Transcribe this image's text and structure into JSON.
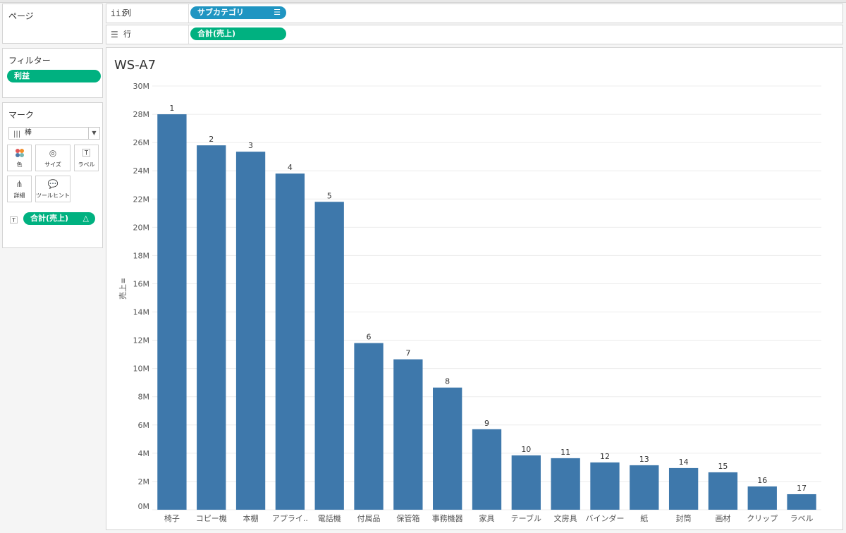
{
  "pages_panel": {
    "title": "ページ"
  },
  "filters_panel": {
    "title": "フィルター",
    "pill": "利益"
  },
  "marks_panel": {
    "title": "マーク",
    "mark_type": "棒",
    "buttons": [
      {
        "label": "色",
        "icon": "color-dots-icon"
      },
      {
        "label": "サイズ",
        "icon": "size-circles-icon"
      },
      {
        "label": "ラベル",
        "icon": "label-text-icon"
      },
      {
        "label": "詳細",
        "icon": "detail-tree-icon"
      },
      {
        "label": "ツールヒント",
        "icon": "tooltip-bubble-icon"
      }
    ],
    "label_pill": "合計(売上)"
  },
  "shelves": {
    "columns": {
      "label": "列",
      "pill": "サブカテゴリ"
    },
    "rows": {
      "label": "行",
      "pill": "合計(売上)"
    }
  },
  "colors": {
    "bar": "#3e78ab",
    "green_pill": "#00b180",
    "blue_pill": "#1f95c2"
  },
  "chart_data": {
    "type": "bar",
    "title": "WS-A7",
    "ylabel": "売上",
    "ylim": [
      0,
      30000000
    ],
    "yticks": [
      0,
      2000000,
      4000000,
      6000000,
      8000000,
      10000000,
      12000000,
      14000000,
      16000000,
      18000000,
      20000000,
      22000000,
      24000000,
      26000000,
      28000000,
      30000000
    ],
    "ytick_labels": [
      "0M",
      "2M",
      "4M",
      "6M",
      "8M",
      "10M",
      "12M",
      "14M",
      "16M",
      "18M",
      "20M",
      "22M",
      "24M",
      "26M",
      "28M",
      "30M"
    ],
    "categories": [
      "椅子",
      "コピー機",
      "本棚",
      "アプライ..",
      "電話機",
      "付属品",
      "保管箱",
      "事務機器",
      "家具",
      "テーブル",
      "文房具",
      "バインダー",
      "紙",
      "封筒",
      "画材",
      "クリップ",
      "ラベル"
    ],
    "values": [
      28000000,
      25800000,
      25350000,
      23800000,
      21800000,
      11800000,
      10650000,
      8650000,
      5700000,
      3850000,
      3650000,
      3350000,
      3150000,
      2950000,
      2650000,
      1650000,
      1100000
    ],
    "data_labels": [
      "1",
      "2",
      "3",
      "4",
      "5",
      "6",
      "7",
      "8",
      "9",
      "10",
      "11",
      "12",
      "13",
      "14",
      "15",
      "16",
      "17"
    ],
    "grid": true
  }
}
